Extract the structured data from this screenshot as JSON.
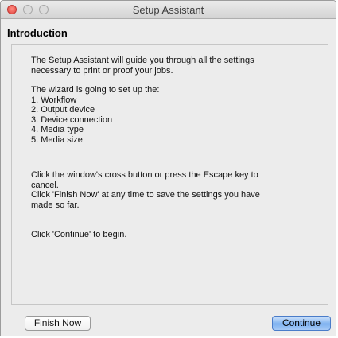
{
  "window": {
    "title": "Setup Assistant"
  },
  "page": {
    "heading": "Introduction"
  },
  "content": {
    "intro": "The Setup Assistant will guide you through all the settings\nnecessary to print or proof your jobs.",
    "steps_title": "The wizard is going to set up the:",
    "steps": [
      "1. Workflow",
      "2. Output device",
      "3. Device connection",
      "4. Media type",
      "5. Media size"
    ],
    "cancel_text": "Click the window's cross button or press the Escape key to\ncancel.",
    "finish_text": "Click 'Finish Now' at any time to save the settings you have\nmade so far.",
    "continue_text": "Click 'Continue' to begin."
  },
  "buttons": {
    "finish_label": "Finish Now",
    "continue_label": "Continue"
  },
  "colors": {
    "close_button": "#e0443e",
    "default_button": "#7fb2f0"
  },
  "icons": {
    "close": "close-window-icon",
    "minimize": "minimize-window-icon",
    "zoom": "zoom-window-icon"
  }
}
